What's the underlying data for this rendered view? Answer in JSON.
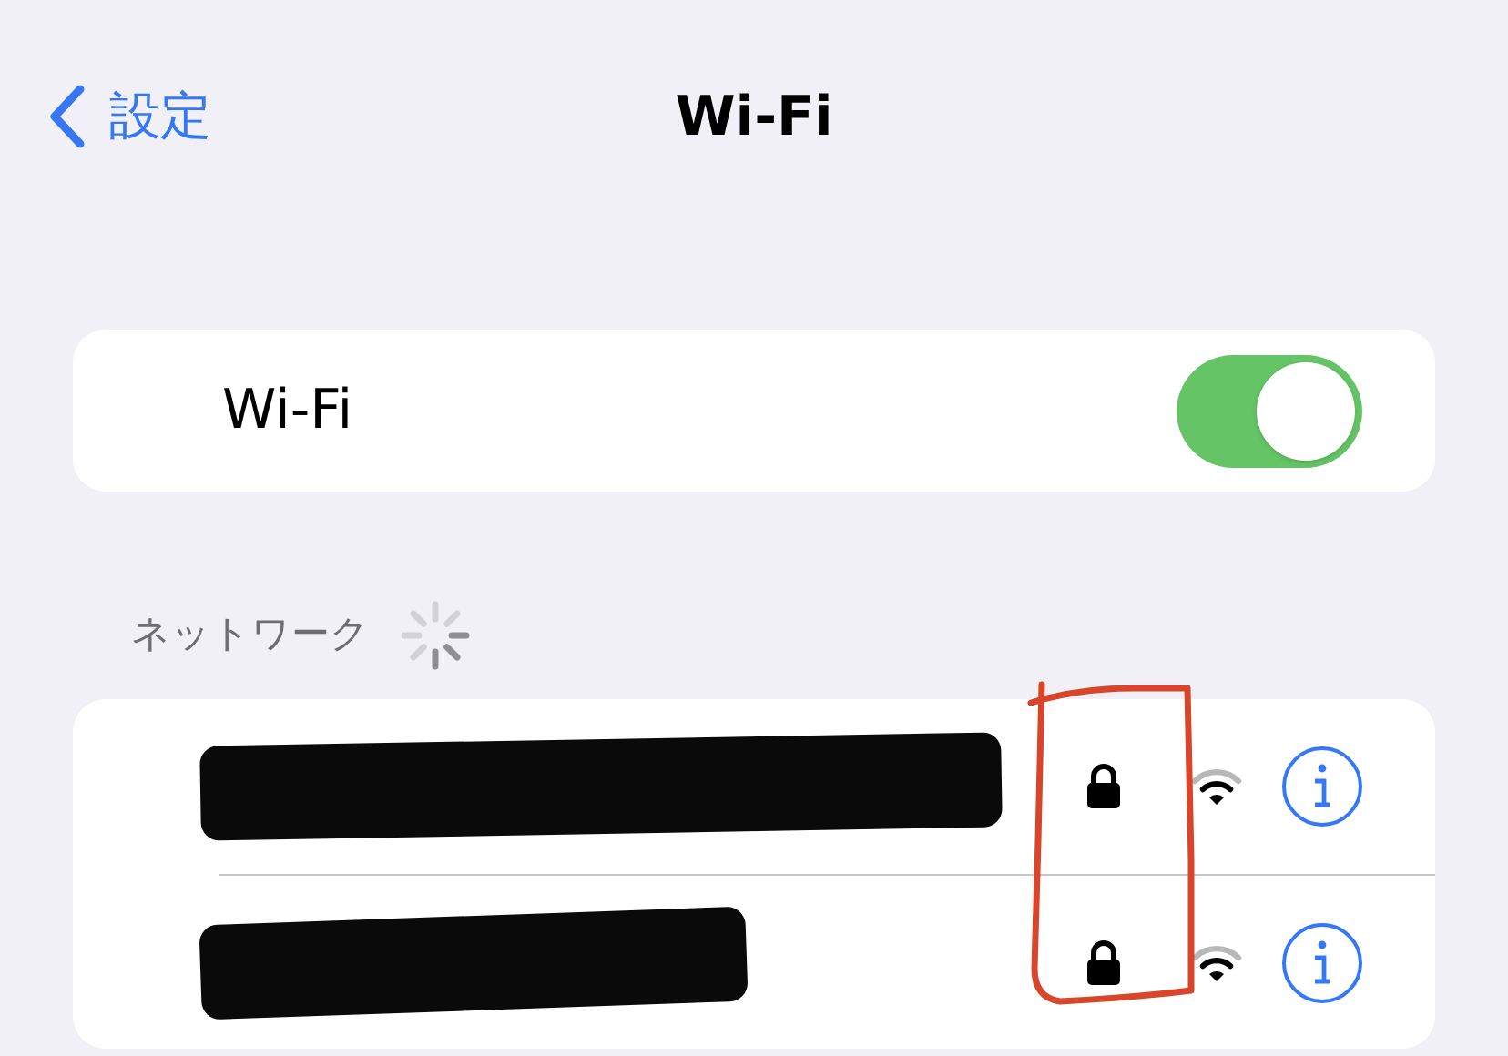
{
  "nav": {
    "back": "設定",
    "title": "Wi-Fi"
  },
  "wifi": {
    "label": "Wi-Fi",
    "on": true
  },
  "networks_header": {
    "label": "ネットワーク",
    "scanning": true
  },
  "networks": [
    {
      "locked": true
    },
    {
      "locked": true
    }
  ]
}
